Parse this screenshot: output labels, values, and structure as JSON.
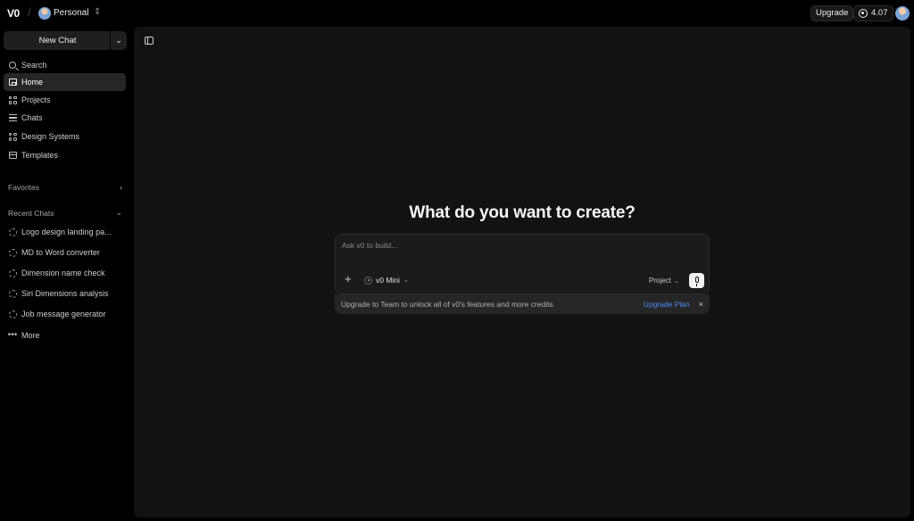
{
  "topbar": {
    "logo": "V0",
    "separator": "/",
    "workspace": "Personal",
    "workspace_switch_icon": "chevron-up-down-icon",
    "upgrade_label": "Upgrade",
    "credits": "4.07"
  },
  "sidebar": {
    "new_chat_label": "New Chat",
    "nav": [
      {
        "label": "Search",
        "icon": "search-icon"
      },
      {
        "label": "Home",
        "icon": "home-icon",
        "active": true
      },
      {
        "label": "Projects",
        "icon": "projects-icon"
      },
      {
        "label": "Chats",
        "icon": "chats-icon"
      },
      {
        "label": "Design Systems",
        "icon": "design-systems-icon"
      },
      {
        "label": "Templates",
        "icon": "templates-icon"
      }
    ],
    "favorites_label": "Favorites",
    "recent_label": "Recent Chats",
    "recent_chats": [
      "Logo design landing pa...",
      "MD to Word converter",
      "Dimension name check",
      "Siri Dimensions analysis",
      "Job message generator"
    ],
    "more_label": "More"
  },
  "main": {
    "headline": "What do you want to create?",
    "composer": {
      "placeholder": "Ask v0 to build...",
      "value": "",
      "model": "v0 Mini",
      "project": "Project"
    },
    "upsell": {
      "message": "Upgrade to Team to unlock all of v0's features and more credits",
      "link": "Upgrade Plan",
      "close": "×"
    }
  }
}
